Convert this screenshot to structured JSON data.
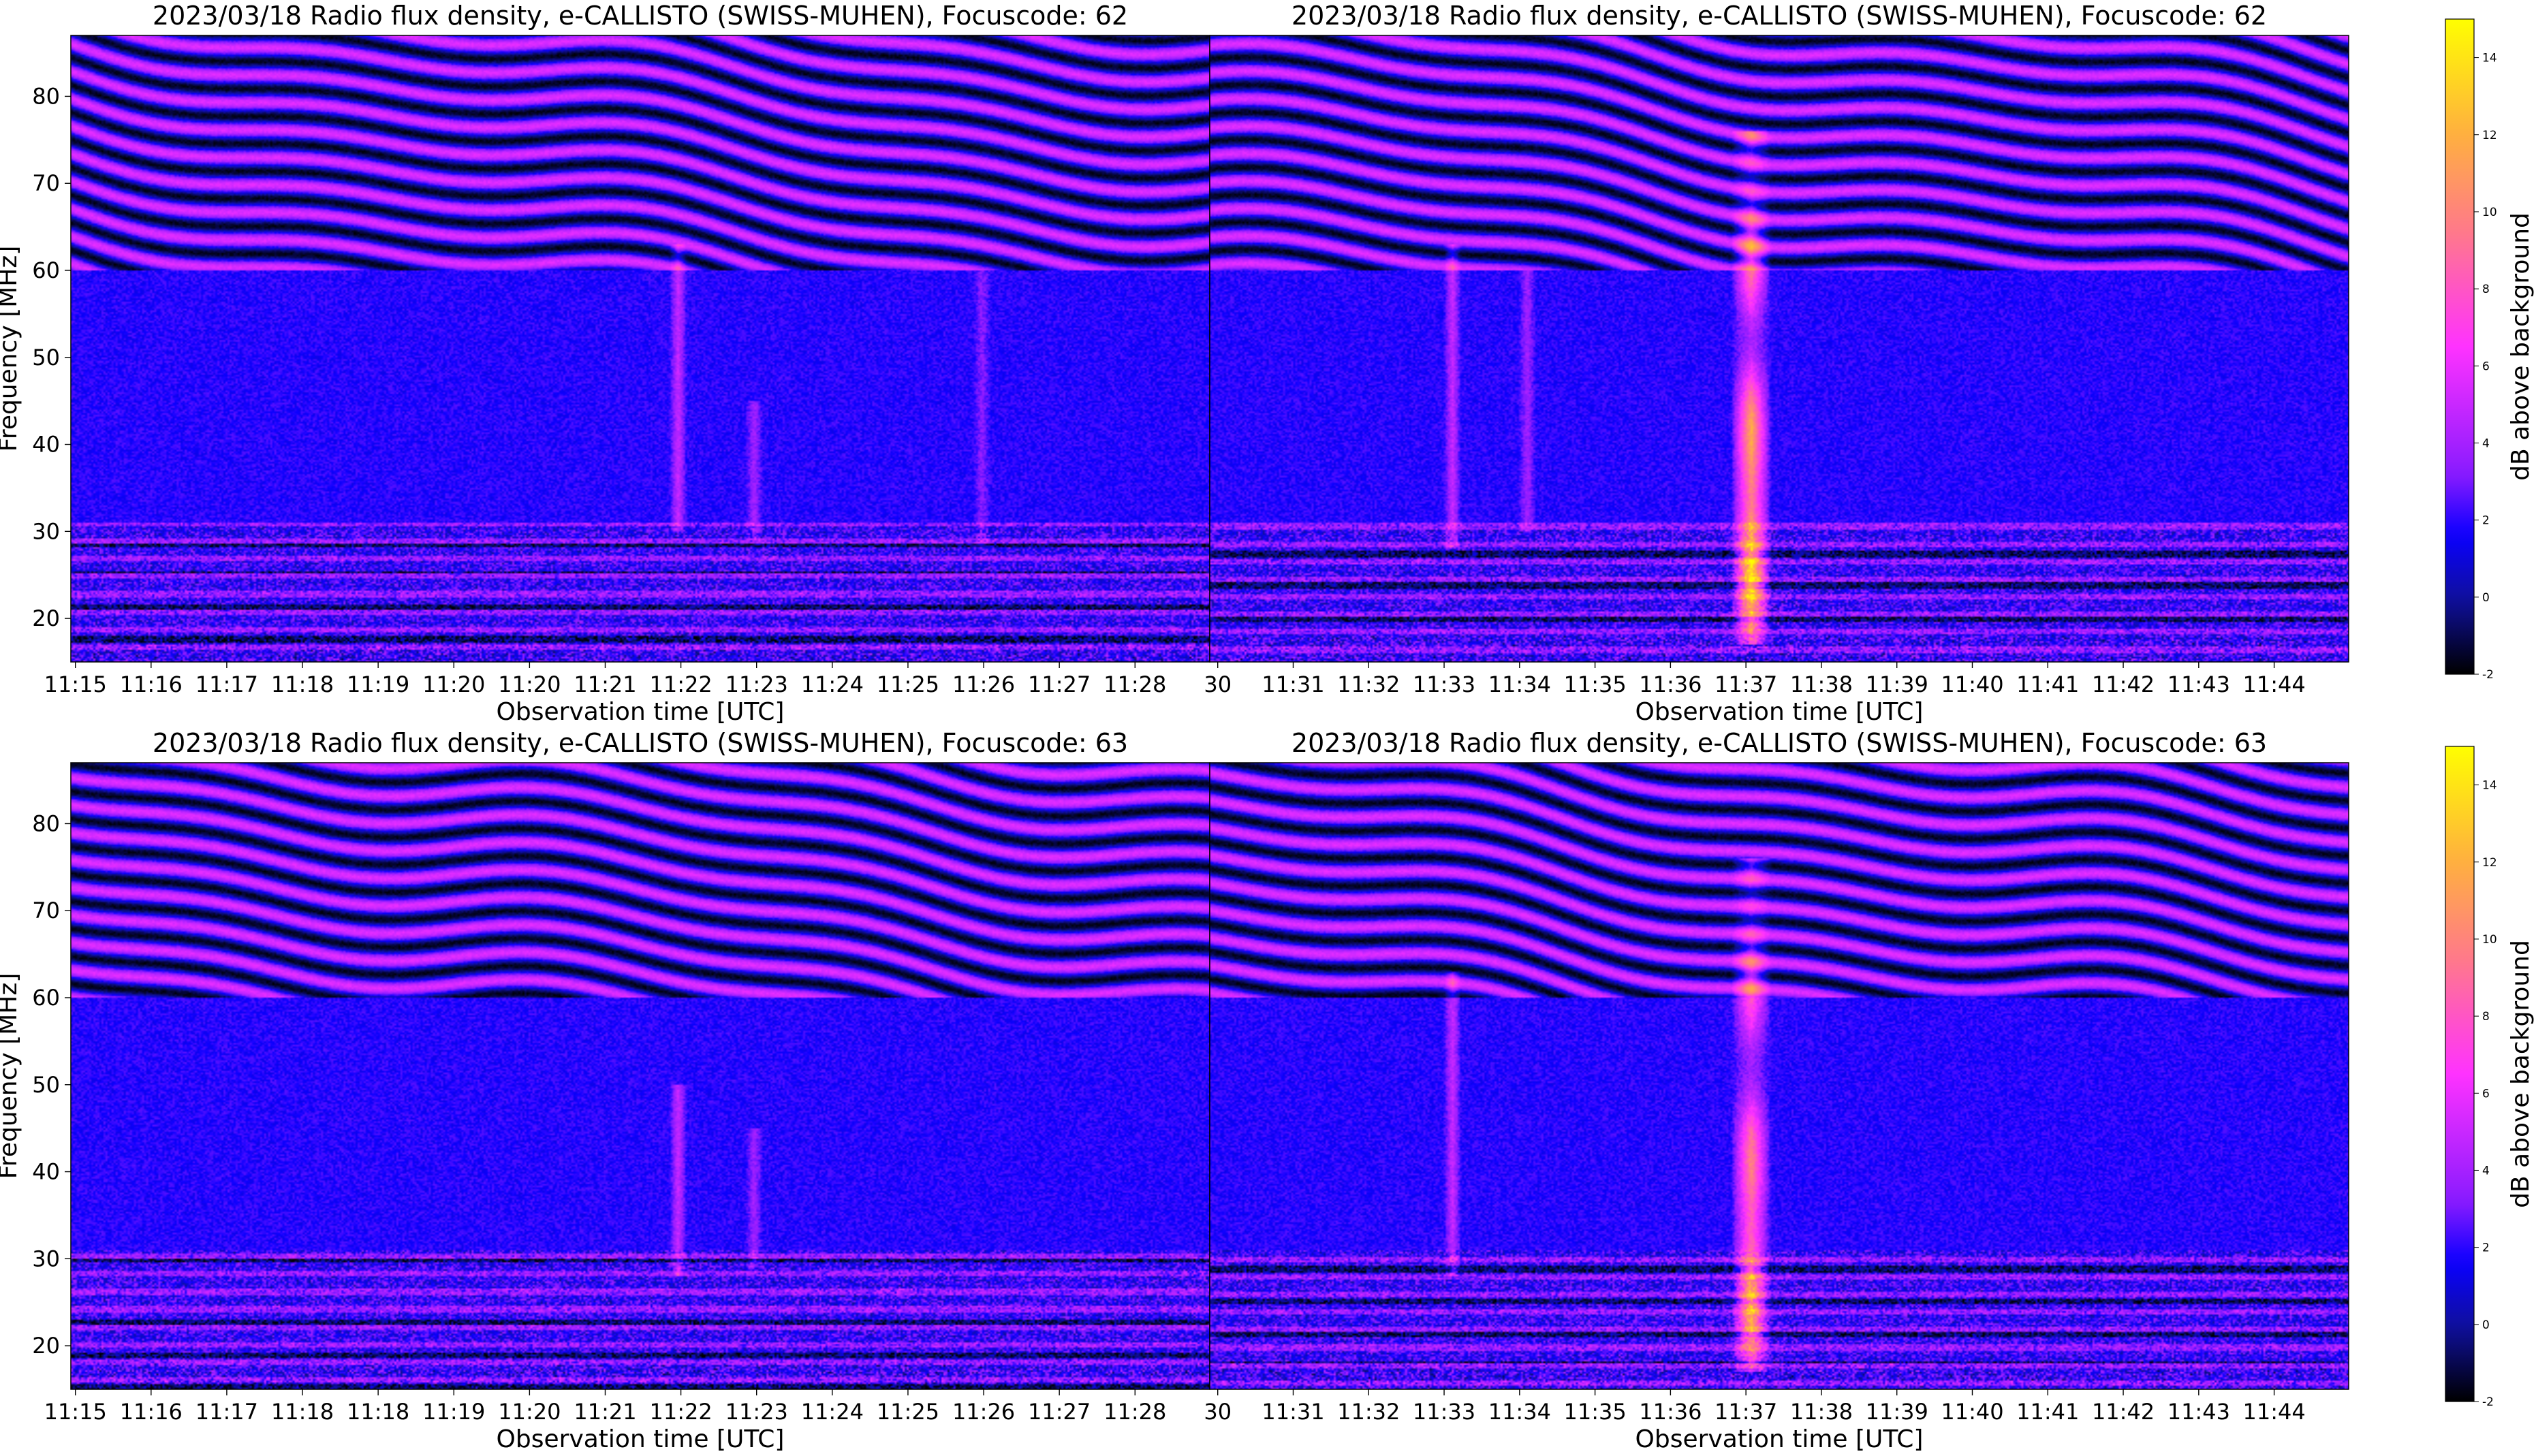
{
  "colors": {
    "colormap": [
      "#000000",
      "#1010a0",
      "#0b00ff",
      "#8a1bff",
      "#ff32ff",
      "#ff7a8a",
      "#ffb040",
      "#ffff00"
    ],
    "spine": "#000000"
  },
  "chart_data": [
    {
      "type": "heatmap",
      "panel": "top-left",
      "title": "2023/03/18  Radio flux density, e-CALLISTO (SWISS-MUHEN), Focuscode: 62",
      "xlabel": "Observation time [UTC]",
      "ylabel": "Frequency [MHz]",
      "xlim": [
        "11:15",
        "11:30"
      ],
      "ylim": [
        15,
        87
      ],
      "xticks": [
        "11:15",
        "11:16",
        "11:17",
        "11:18",
        "11:19",
        "11:20",
        "11:20",
        "11:21",
        "11:22",
        "11:23",
        "11:24",
        "11:25",
        "11:26",
        "11:27",
        "11:28"
      ],
      "yticks": [
        20,
        30,
        40,
        50,
        60,
        70,
        80
      ],
      "features": [
        {
          "kind": "rfi_band_lines",
          "fmin": 60,
          "fmax": 87
        },
        {
          "kind": "vertical_streak",
          "time": "11:23",
          "fmin": 30,
          "fmax": 63,
          "intensity": 3
        },
        {
          "kind": "vertical_streak",
          "time": "11:24",
          "fmin": 29,
          "fmax": 45,
          "intensity": 2
        },
        {
          "kind": "vertical_streak",
          "time": "11:27",
          "fmin": 28,
          "fmax": 60,
          "intensity": 1.5
        }
      ]
    },
    {
      "type": "heatmap",
      "panel": "top-right",
      "title": "2023/03/18  Radio flux density, e-CALLISTO (SWISS-MUHEN), Focuscode: 62",
      "xlabel": "Observation time [UTC]",
      "xlim": [
        "11:29:45",
        "11:45"
      ],
      "ylim": [
        15,
        87
      ],
      "xticks": [
        "30",
        "11:31",
        "11:32",
        "11:33",
        "11:34",
        "11:35",
        "11:36",
        "11:37",
        "11:38",
        "11:39",
        "11:40",
        "11:41",
        "11:42",
        "11:43",
        "11:44"
      ],
      "features": [
        {
          "kind": "rfi_band_lines",
          "fmin": 60,
          "fmax": 87
        },
        {
          "kind": "radio_burst",
          "time": "11:37",
          "fmin": 17,
          "fmax": 76,
          "peak_db": 11
        },
        {
          "kind": "vertical_streak",
          "time": "11:33",
          "fmin": 28,
          "fmax": 63,
          "intensity": 3
        },
        {
          "kind": "vertical_streak",
          "time": "11:34",
          "fmin": 30,
          "fmax": 60,
          "intensity": 2
        }
      ]
    },
    {
      "type": "heatmap",
      "panel": "bottom-left",
      "title": "2023/03/18  Radio flux density, e-CALLISTO (SWISS-MUHEN), Focuscode: 63",
      "xlabel": "Observation time [UTC]",
      "ylabel": "Frequency [MHz]",
      "xlim": [
        "11:15",
        "11:30"
      ],
      "ylim": [
        15,
        87
      ],
      "xticks": [
        "11:15",
        "11:16",
        "11:17",
        "11:18",
        "11:18",
        "11:19",
        "11:20",
        "11:21",
        "11:22",
        "11:23",
        "11:24",
        "11:25",
        "11:26",
        "11:27",
        "11:28"
      ],
      "yticks": [
        20,
        30,
        40,
        50,
        60,
        70,
        80
      ],
      "features": [
        {
          "kind": "rfi_band_lines",
          "fmin": 60,
          "fmax": 87
        },
        {
          "kind": "vertical_streak",
          "time": "11:23",
          "fmin": 28,
          "fmax": 50,
          "intensity": 3
        },
        {
          "kind": "vertical_streak",
          "time": "11:24",
          "fmin": 29,
          "fmax": 45,
          "intensity": 2
        }
      ]
    },
    {
      "type": "heatmap",
      "panel": "bottom-right",
      "title": "2023/03/18  Radio flux density, e-CALLISTO (SWISS-MUHEN), Focuscode: 63",
      "xlabel": "Observation time [UTC]",
      "xlim": [
        "11:29:45",
        "11:45"
      ],
      "ylim": [
        15,
        87
      ],
      "xticks": [
        "30",
        "11:31",
        "11:32",
        "11:33",
        "11:34",
        "11:35",
        "11:36",
        "11:37",
        "11:38",
        "11:39",
        "11:40",
        "11:41",
        "11:42",
        "11:43",
        "11:44"
      ],
      "features": [
        {
          "kind": "rfi_band_lines",
          "fmin": 60,
          "fmax": 87
        },
        {
          "kind": "radio_burst",
          "time": "11:37",
          "fmin": 17,
          "fmax": 76,
          "peak_db": 9
        },
        {
          "kind": "vertical_streak",
          "time": "11:33",
          "fmin": 28,
          "fmax": 63,
          "intensity": 3
        }
      ]
    }
  ],
  "colorbars": [
    {
      "label": "dB above background",
      "min": -2,
      "max": 15,
      "ticks": [
        -2,
        0,
        2,
        4,
        6,
        8,
        10,
        12,
        14
      ]
    },
    {
      "label": "dB above background",
      "min": -2,
      "max": 15,
      "ticks": [
        -2,
        0,
        2,
        4,
        6,
        8,
        10,
        12,
        14
      ]
    }
  ]
}
